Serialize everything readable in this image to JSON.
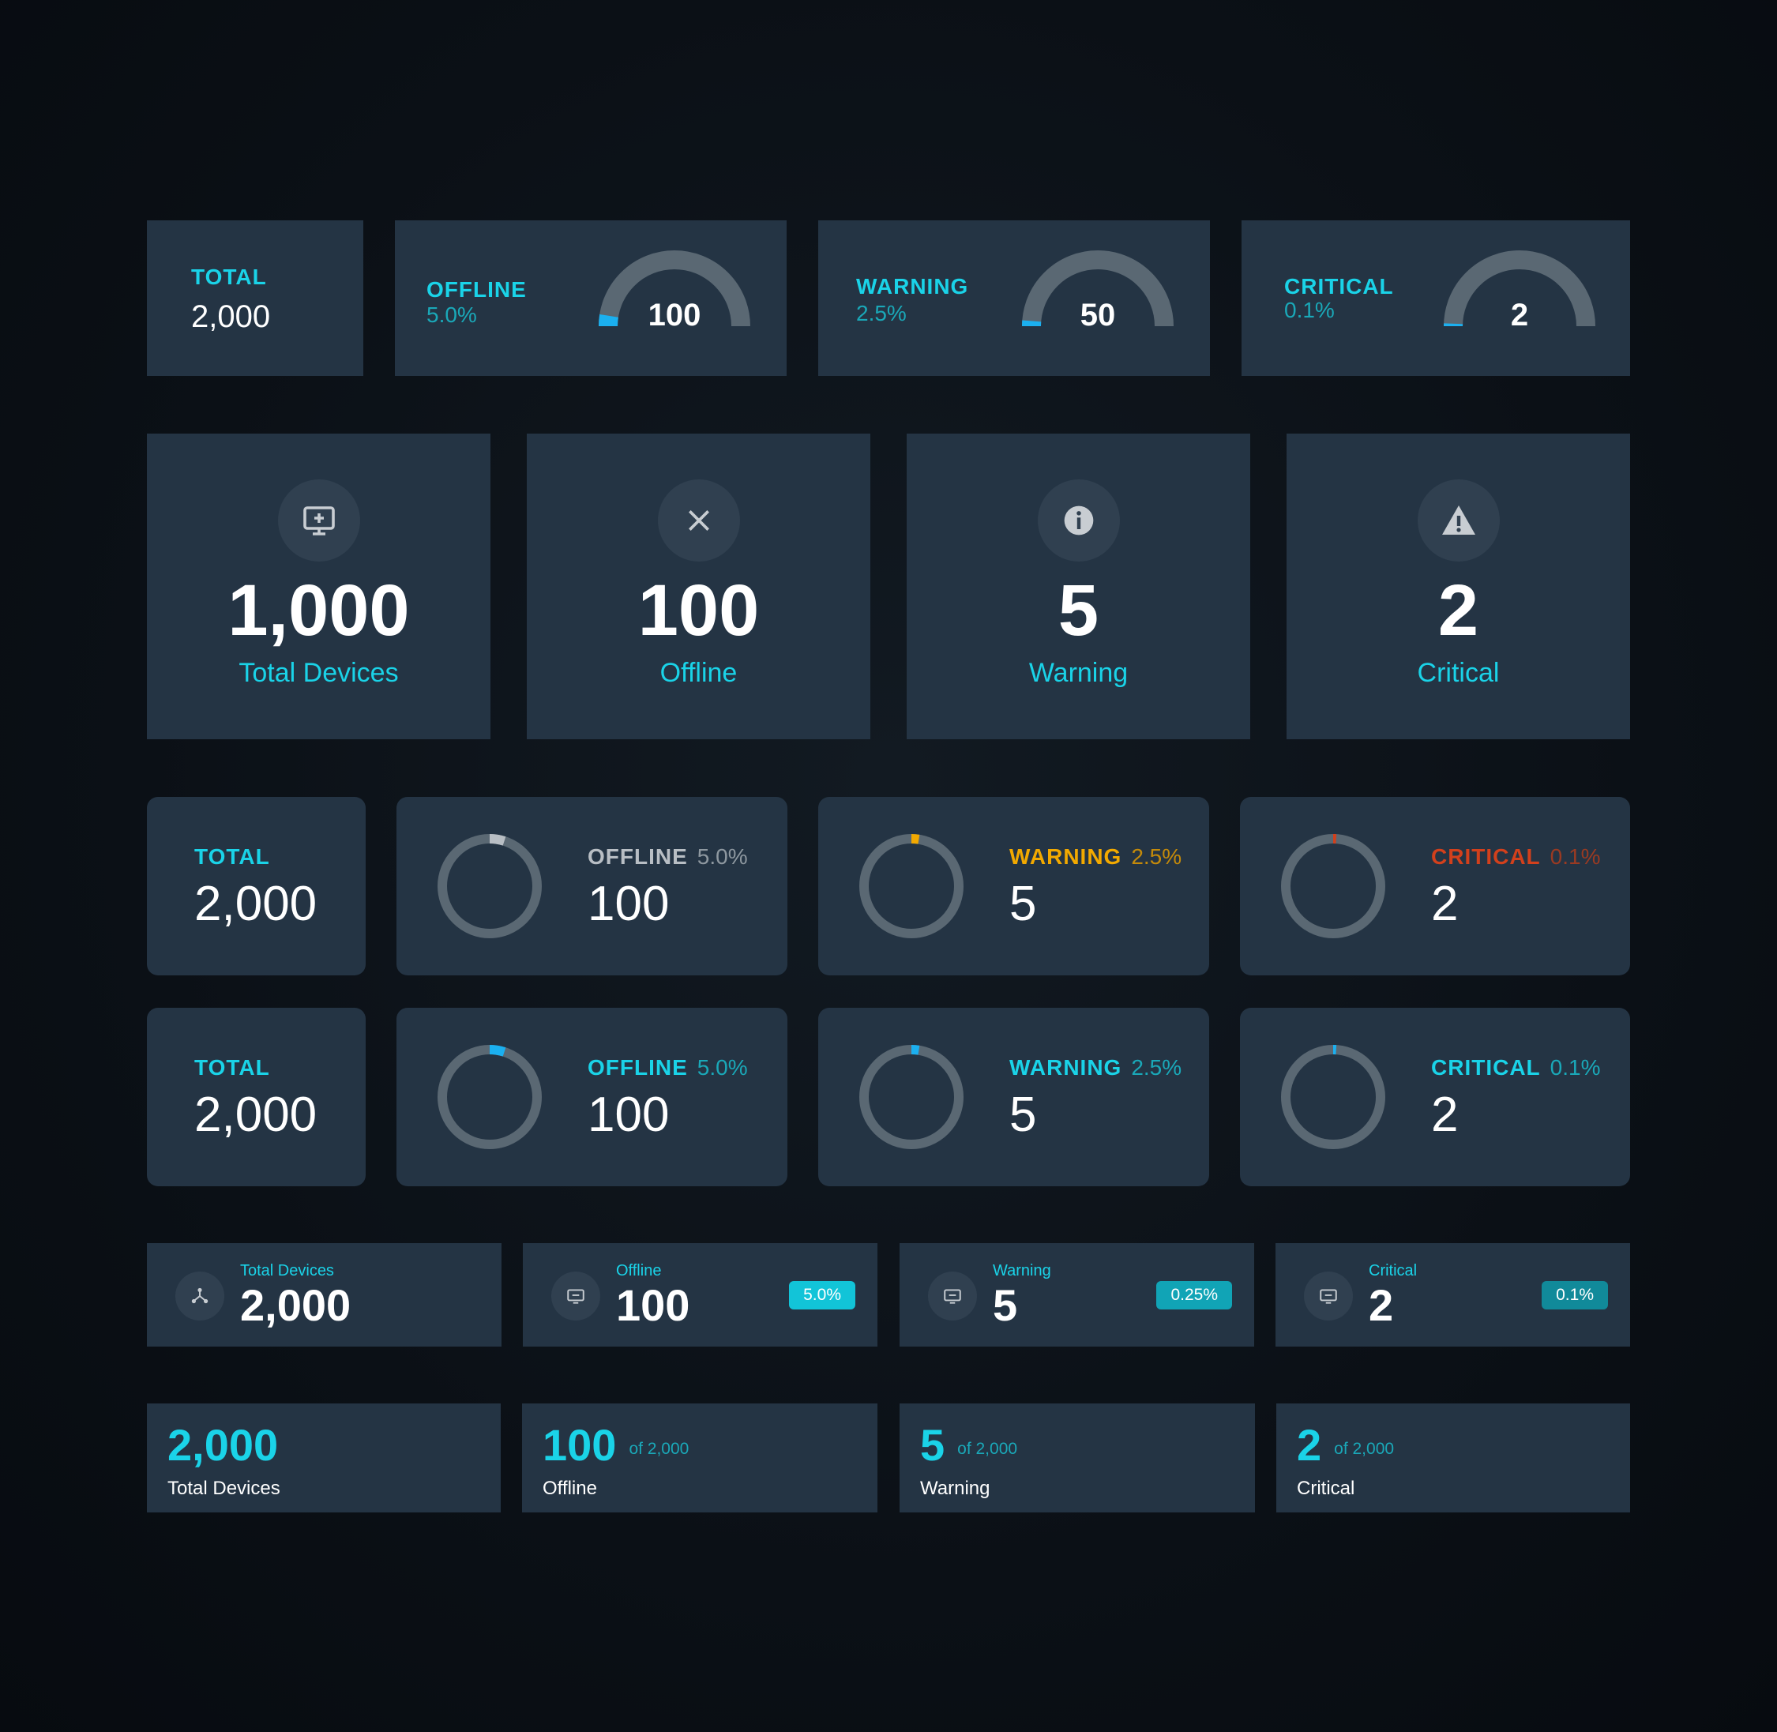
{
  "row1": {
    "total": {
      "label": "TOTAL",
      "value": "2,000"
    },
    "offline": {
      "label": "OFFLINE",
      "pct": "5.0%",
      "value": "100",
      "fill": 0.05
    },
    "warning": {
      "label": "WARNING",
      "pct": "2.5%",
      "value": "50",
      "fill": 0.025
    },
    "critical": {
      "label": "CRITICAL",
      "pct": "0.1%",
      "value": "2",
      "fill": 0.001
    }
  },
  "row2": {
    "total": {
      "value": "1,000",
      "caption": "Total Devices",
      "icon": "monitor-plus-icon"
    },
    "offline": {
      "value": "100",
      "caption": "Offline",
      "icon": "close-icon"
    },
    "warning": {
      "value": "5",
      "caption": "Warning",
      "icon": "info-icon"
    },
    "critical": {
      "value": "2",
      "caption": "Critical",
      "icon": "alert-triangle-icon"
    }
  },
  "row3": {
    "total": {
      "label": "TOTAL",
      "value": "2,000"
    },
    "offline": {
      "label": "OFFLINE",
      "pct": "5.0%",
      "value": "100",
      "fill": 0.05
    },
    "warning": {
      "label": "WARNING",
      "pct": "2.5%",
      "value": "5",
      "fill": 0.025
    },
    "critical": {
      "label": "CRITICAL",
      "pct": "0.1%",
      "value": "2",
      "fill": 0.01
    }
  },
  "row4": {
    "total": {
      "label": "TOTAL",
      "value": "2,000"
    },
    "offline": {
      "label": "OFFLINE",
      "pct": "5.0%",
      "value": "100",
      "fill": 0.05
    },
    "warning": {
      "label": "WARNING",
      "pct": "2.5%",
      "value": "5",
      "fill": 0.025
    },
    "critical": {
      "label": "CRITICAL",
      "pct": "0.1%",
      "value": "2",
      "fill": 0.01
    }
  },
  "row5": {
    "total": {
      "label": "Total Devices",
      "value": "2,000",
      "icon": "network-icon"
    },
    "offline": {
      "label": "Offline",
      "value": "100",
      "badge": "5.0%",
      "icon": "monitor-icon"
    },
    "warning": {
      "label": "Warning",
      "value": "5",
      "badge": "0.25%",
      "icon": "monitor-icon"
    },
    "critical": {
      "label": "Critical",
      "value": "2",
      "badge": "0.1%",
      "icon": "monitor-icon"
    }
  },
  "row6": {
    "total": {
      "value": "2,000",
      "caption": "Total Devices"
    },
    "offline": {
      "value": "100",
      "of": "of 2,000",
      "caption": "Offline"
    },
    "warning": {
      "value": "5",
      "of": "of 2,000",
      "caption": "Warning"
    },
    "critical": {
      "value": "2",
      "of": "of 2,000",
      "caption": "Critical"
    }
  },
  "colors": {
    "accent": "#1ad3e8",
    "gauge_fill": "#1bb0f0",
    "track": "#5a6873",
    "warning": "#f2a900",
    "critical": "#d2401c",
    "offline_grey": "#b8bec4",
    "badge_bright": "#12c4d8",
    "badge_dim": "#118a9a"
  }
}
